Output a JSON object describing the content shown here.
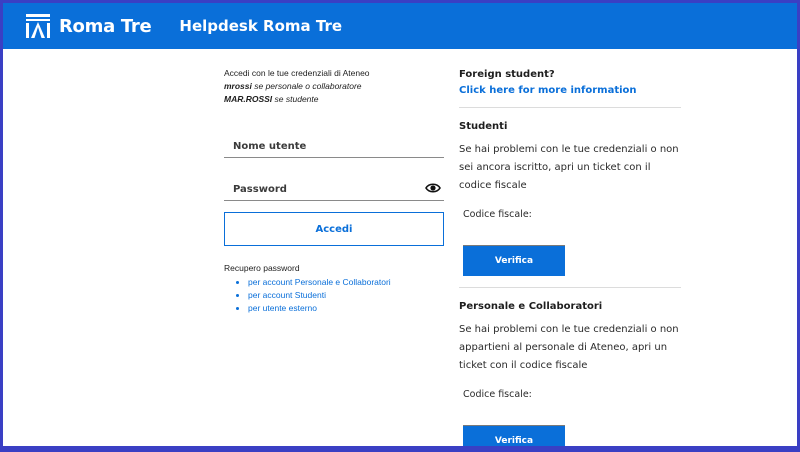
{
  "header": {
    "logo_text": "Roma Tre",
    "site_title": "Helpdesk Roma Tre",
    "brand_color": "#0a6fd9"
  },
  "login": {
    "intro_line1": "Accedi con le tue credenziali di Ateneo",
    "example1_user": "mrossi",
    "example1_text": " se personale o collaboratore",
    "example2_user": "MAR.ROSSI",
    "example2_text": " se studente",
    "username_placeholder": "Nome utente",
    "password_placeholder": "Password",
    "submit_label": "Accedi",
    "recovery_title": "Recupero password",
    "recovery_links": [
      "per account Personale e Collaboratori",
      "per account Studenti",
      "per utente esterno"
    ]
  },
  "foreign": {
    "title": "Foreign student?",
    "link": "Click here for more information"
  },
  "students": {
    "title": "Studenti",
    "description": "Se hai problemi con le tue credenziali o non sei ancora iscritto, apri un ticket con il codice fiscale",
    "cf_label": "Codice fiscale:",
    "button_label": "Verifica"
  },
  "staff": {
    "title": "Personale e Collaboratori",
    "description": "Se hai problemi con le tue credenziali o non appartieni al personale di Ateneo, apri un ticket con il codice fiscale",
    "cf_label": "Codice fiscale:",
    "button_label": "Verifica"
  }
}
